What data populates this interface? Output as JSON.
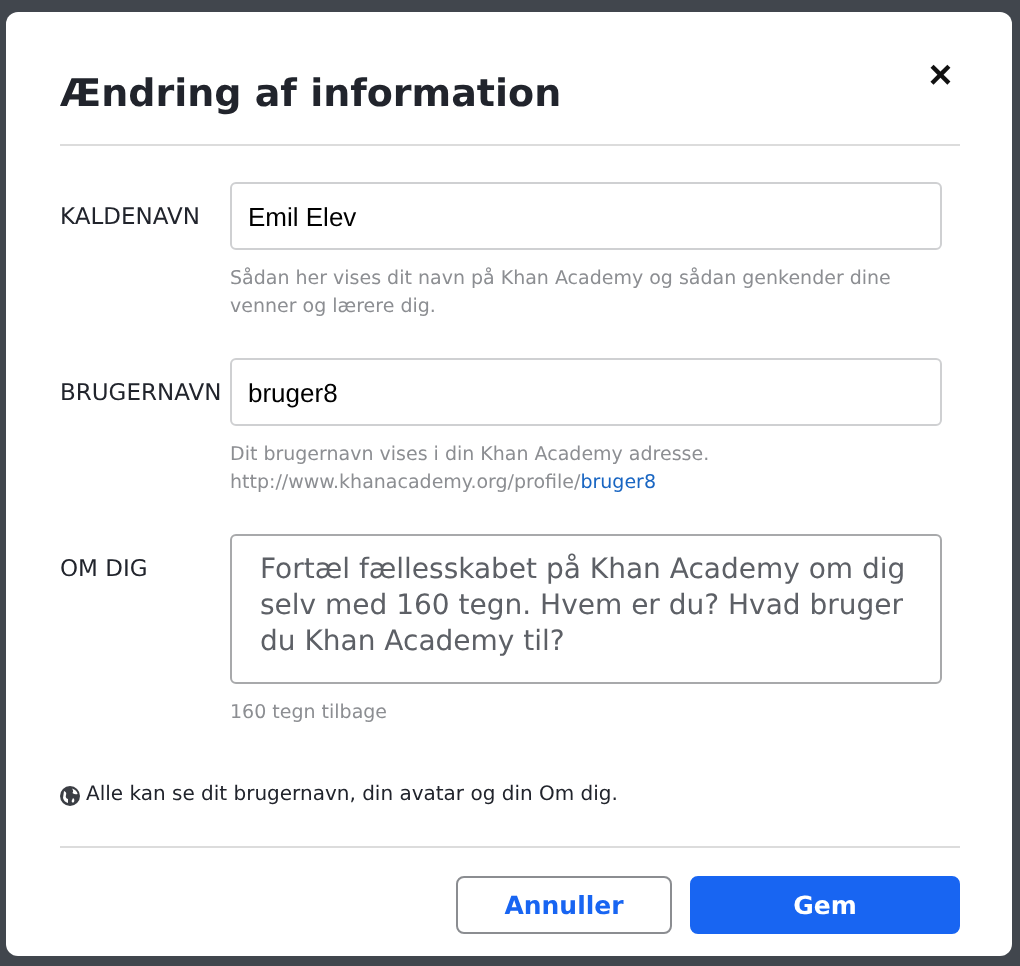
{
  "dialog": {
    "title": "Ændring af information",
    "close": "×"
  },
  "fields": [
    {
      "kind": "input",
      "label": "KALDENAVN",
      "value": "Emil Elev",
      "help": "Sådan her vises dit navn på Khan Academy og sådan genkender dine venner og lærere dig."
    },
    {
      "kind": "input",
      "label": "BRUGERNAVN",
      "value": "bruger8",
      "help": "Dit brugernavn vises i din Khan Academy adresse.",
      "url_prefix": "http://www.khanacademy.org/profile/",
      "url_link": "bruger8"
    },
    {
      "kind": "textarea",
      "label": "OM DIG",
      "placeholder": "Fortæl fællesskabet på Khan Academy om dig selv med 160 tegn. Hvem er du? Hvad bruger du Khan Academy til?",
      "help": "160 tegn tilbage"
    }
  ],
  "notice": "Alle kan se dit brugernavn, din avatar og din Om dig.",
  "buttons": [
    {
      "label": "Annuller",
      "kind": "secondary"
    },
    {
      "label": "Gem",
      "kind": "primary"
    }
  ]
}
